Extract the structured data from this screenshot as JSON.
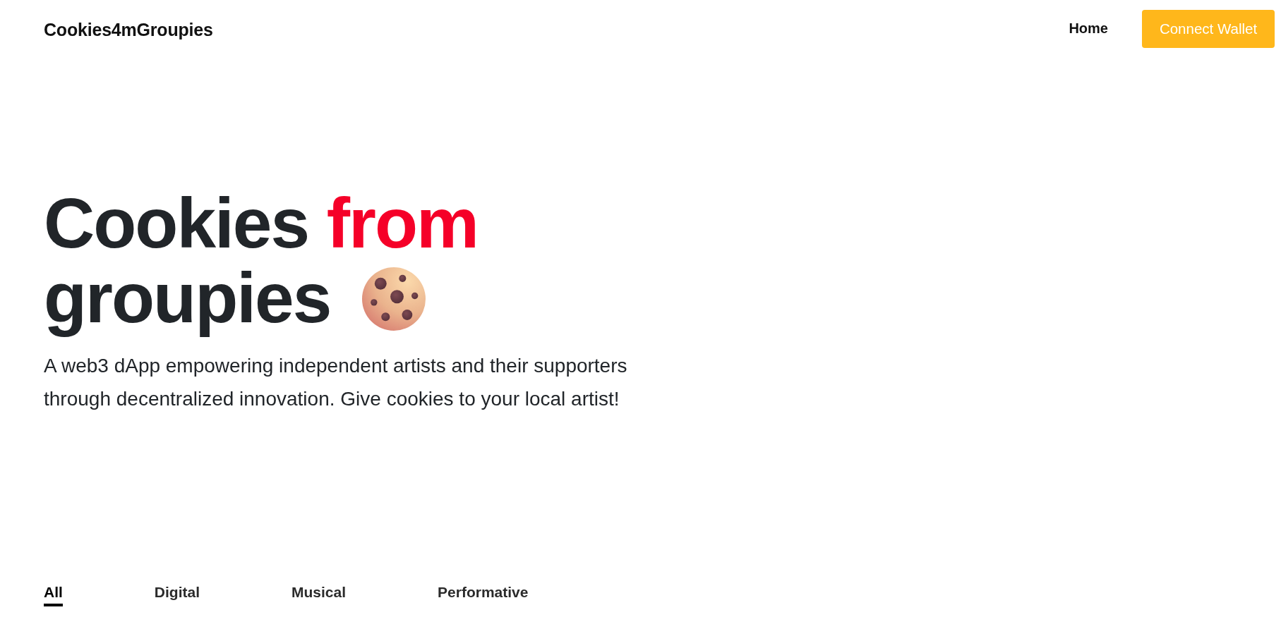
{
  "header": {
    "logo": "Cookies4mGroupies",
    "nav": [
      {
        "label": "Home"
      }
    ],
    "connect_button": "Connect Wallet"
  },
  "hero": {
    "title_lines": [
      {
        "words": [
          {
            "text": "Cookies",
            "highlight": false
          },
          {
            "text": "from",
            "highlight": true
          }
        ]
      },
      {
        "words": [
          {
            "text": "groupies",
            "highlight": false
          }
        ]
      }
    ],
    "subtitle": "A web3 dApp empowering independent artists and their supporters through decentralized innovation. Give cookies to your local artist!"
  },
  "tabs": [
    {
      "label": "All",
      "selected": true
    },
    {
      "label": "Digital",
      "selected": false
    },
    {
      "label": "Musical",
      "selected": false
    },
    {
      "label": "Performative",
      "selected": false
    }
  ]
}
